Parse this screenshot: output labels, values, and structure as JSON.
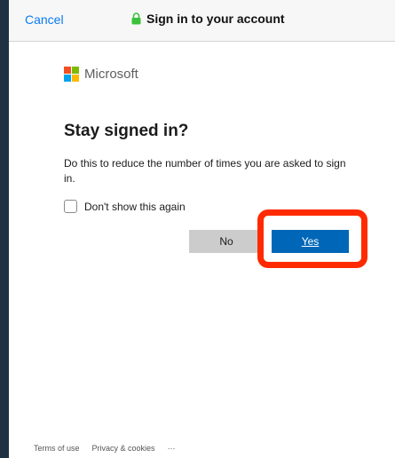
{
  "window": {
    "cancel_label": "Cancel",
    "title": "Sign in to your account",
    "lock_icon": "lock-icon",
    "lock_color": "#3cc13b"
  },
  "brand": {
    "name": "Microsoft",
    "colors": [
      "#f25022",
      "#7fba00",
      "#00a4ef",
      "#ffb900"
    ]
  },
  "dialog": {
    "heading": "Stay signed in?",
    "description": "Do this to reduce the number of times you are asked to sign in.",
    "checkbox_label": "Don't show this again",
    "checkbox_checked": false,
    "no_label": "No",
    "yes_label": "Yes",
    "accent_color": "#0067b8",
    "highlight_color": "#ff2a00"
  },
  "footer": {
    "terms": "Terms of use",
    "privacy": "Privacy & cookies",
    "more": "···"
  }
}
